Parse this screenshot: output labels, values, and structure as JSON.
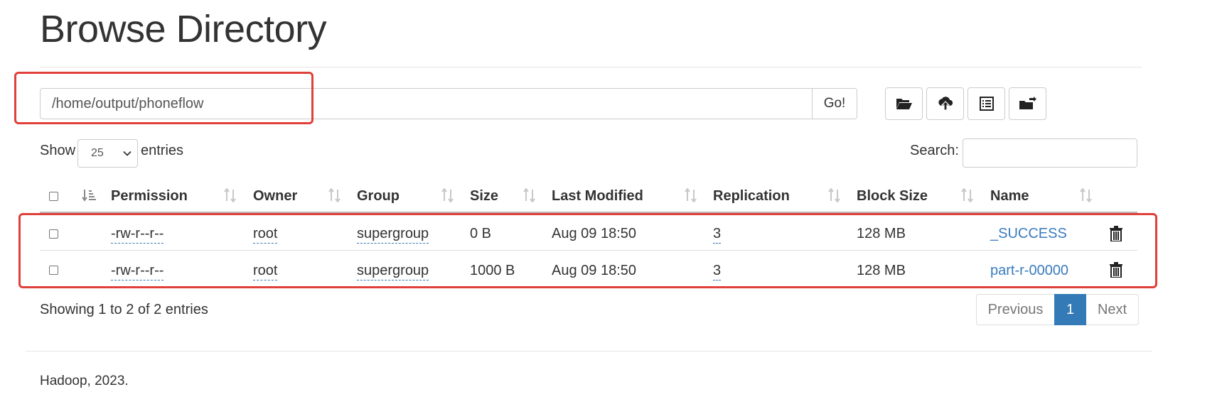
{
  "page": {
    "title": "Browse Directory"
  },
  "path_bar": {
    "value": "/home/output/phoneflow",
    "go_label": "Go!"
  },
  "toolbar": [
    {
      "name": "create-directory",
      "icon": "folder-open-icon"
    },
    {
      "name": "upload",
      "icon": "cloud-upload-icon"
    },
    {
      "name": "list-view",
      "icon": "list-alt-icon"
    },
    {
      "name": "move-folder",
      "icon": "folder-transfer-icon"
    }
  ],
  "length_control": {
    "show_label": "Show",
    "value": "25",
    "entries_label": "entries"
  },
  "search": {
    "label": "Search:",
    "value": ""
  },
  "table": {
    "columns": [
      "Permission",
      "Owner",
      "Group",
      "Size",
      "Last Modified",
      "Replication",
      "Block Size",
      "Name"
    ],
    "rows": [
      {
        "permission": "-rw-r--r--",
        "owner": "root",
        "group": "supergroup",
        "size": "0 B",
        "last_modified": "Aug 09 18:50",
        "replication": "3",
        "block_size": "128 MB",
        "name": "_SUCCESS"
      },
      {
        "permission": "-rw-r--r--",
        "owner": "root",
        "group": "supergroup",
        "size": "1000 B",
        "last_modified": "Aug 09 18:50",
        "replication": "3",
        "block_size": "128 MB",
        "name": "part-r-00000"
      }
    ]
  },
  "info": "Showing 1 to 2 of 2 entries",
  "pagination": {
    "previous": "Previous",
    "current": "1",
    "next": "Next"
  },
  "footer": "Hadoop, 2023.",
  "colors": {
    "link": "#3a7bbf",
    "primary": "#337ab7",
    "highlight": "#e0403a"
  }
}
